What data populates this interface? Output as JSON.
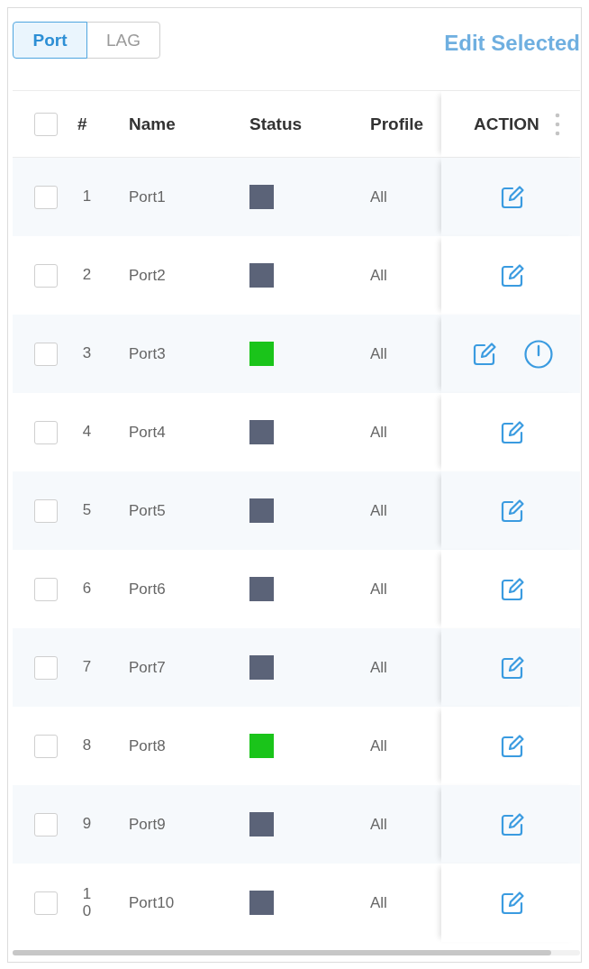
{
  "tabs": [
    {
      "label": "Port",
      "selected": true
    },
    {
      "label": "LAG",
      "selected": false
    }
  ],
  "edit_selected": {
    "label": "Edit Selected",
    "disabled": true
  },
  "table": {
    "select_all_checked": false,
    "columns": [
      "#",
      "Name",
      "Status",
      "Profile",
      "ACTION"
    ],
    "rows": [
      {
        "checked": false,
        "number": "1",
        "name": "Port1",
        "color": "#5b6378",
        "profile": "All",
        "actions": [
          {
            "kind": "edit"
          }
        ]
      },
      {
        "checked": false,
        "number": "2",
        "name": "Port2",
        "color": "#5b6378",
        "profile": "All",
        "actions": [
          {
            "kind": "edit"
          }
        ]
      },
      {
        "checked": false,
        "number": "3",
        "name": "Port3",
        "color": "#1ac41a",
        "profile": "All",
        "actions": [
          {
            "kind": "edit"
          },
          {
            "kind": "power"
          }
        ]
      },
      {
        "checked": false,
        "number": "4",
        "name": "Port4",
        "color": "#5b6378",
        "profile": "All",
        "actions": [
          {
            "kind": "edit"
          }
        ]
      },
      {
        "checked": false,
        "number": "5",
        "name": "Port5",
        "color": "#5b6378",
        "profile": "All",
        "actions": [
          {
            "kind": "edit"
          }
        ]
      },
      {
        "checked": false,
        "number": "6",
        "name": "Port6",
        "color": "#5b6378",
        "profile": "All",
        "actions": [
          {
            "kind": "edit"
          }
        ]
      },
      {
        "checked": false,
        "number": "7",
        "name": "Port7",
        "color": "#5b6378",
        "profile": "All",
        "actions": [
          {
            "kind": "edit"
          }
        ]
      },
      {
        "checked": false,
        "number": "8",
        "name": "Port8",
        "color": "#1ac41a",
        "profile": "All",
        "actions": [
          {
            "kind": "edit"
          }
        ]
      },
      {
        "checked": false,
        "number": "9",
        "name": "Port9",
        "color": "#5b6378",
        "profile": "All",
        "actions": [
          {
            "kind": "edit"
          }
        ]
      },
      {
        "checked": false,
        "number": "10",
        "name": "Port10",
        "color": "#5b6378",
        "profile": "All",
        "actions": [
          {
            "kind": "edit"
          }
        ]
      }
    ]
  }
}
